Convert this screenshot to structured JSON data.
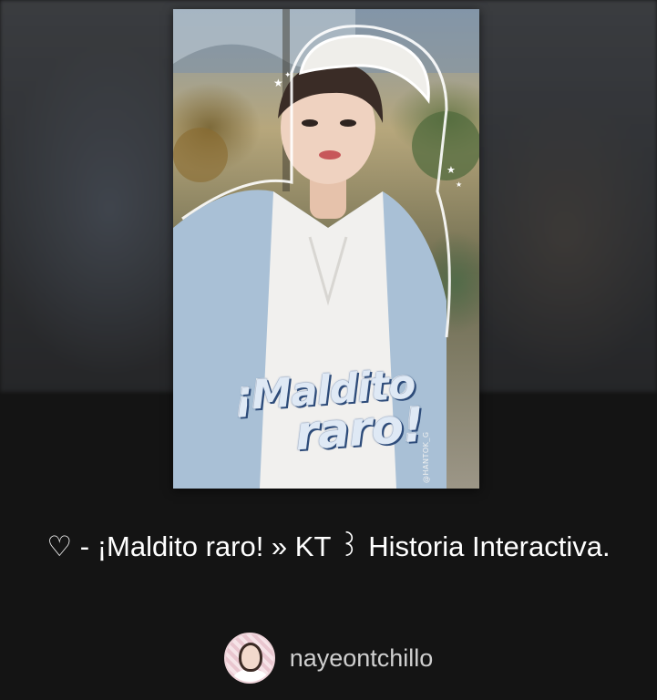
{
  "cover": {
    "title_line1": "¡Maldito",
    "title_line2": "raro!",
    "watermark": "@HANTOK_G"
  },
  "story": {
    "title": "♡ - ¡Maldito raro! » KT ꒱ Historia Interactiva."
  },
  "author": {
    "username": "nayeontchillo",
    "avatar_icon": "user-avatar"
  },
  "colors": {
    "background": "#141414",
    "title_text": "#ffffff",
    "username_text": "#cfcfcf"
  }
}
